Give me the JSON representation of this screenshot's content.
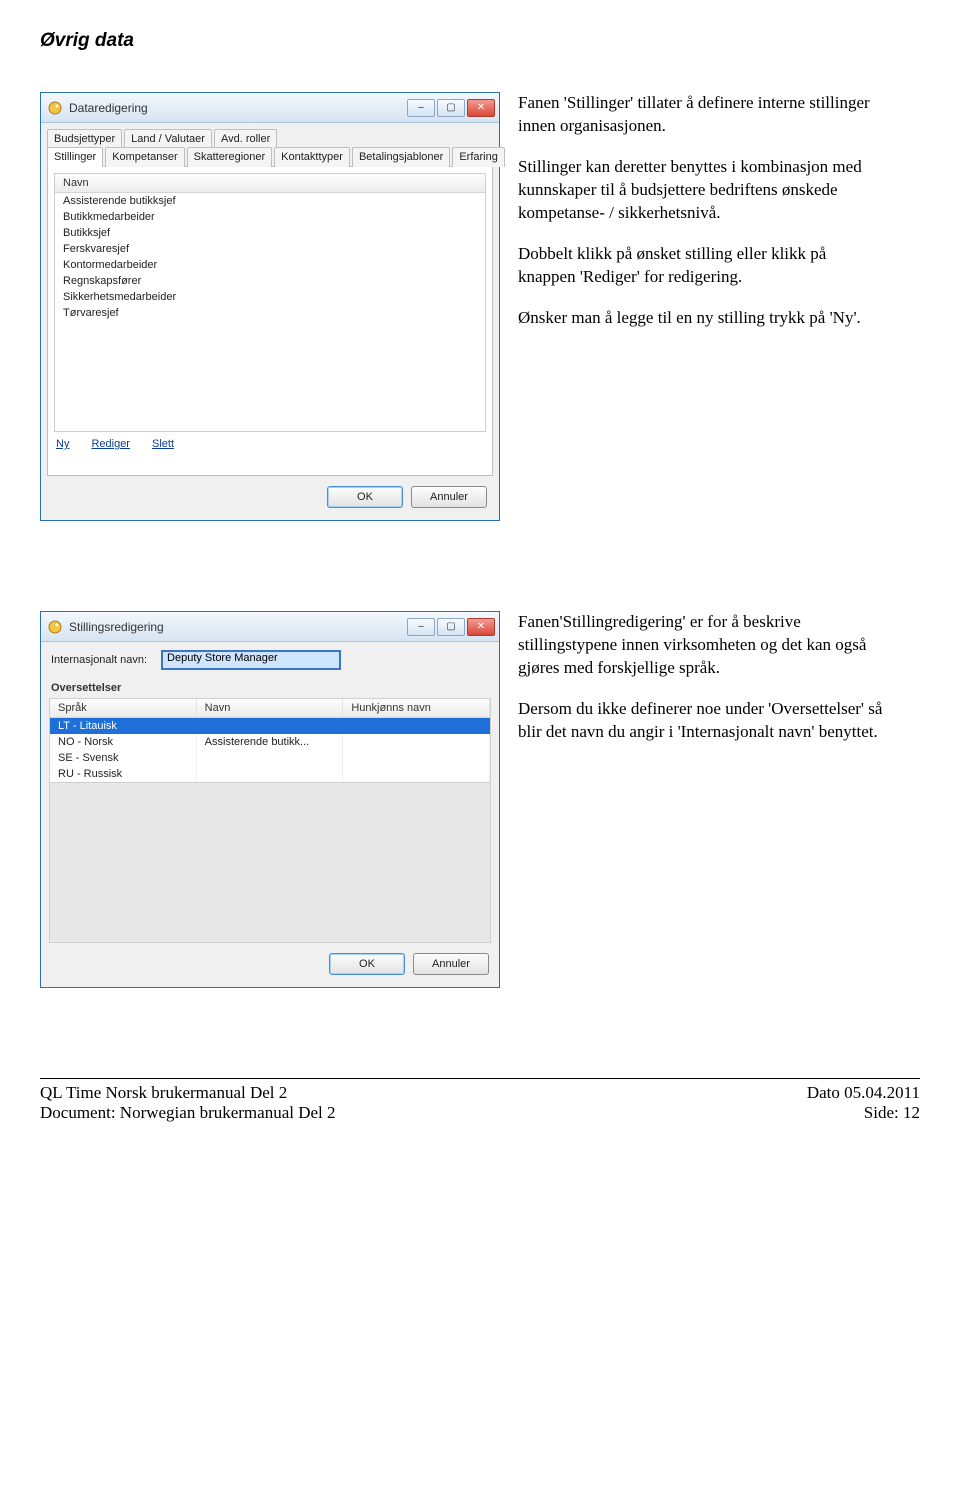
{
  "page": {
    "heading": "Øvrig data"
  },
  "win1": {
    "title": "Dataredigering",
    "tabs_row1": [
      "Budsjettyper",
      "Land / Valutaer",
      "Avd. roller"
    ],
    "tabs_row2": [
      "Stillinger",
      "Kompetanser",
      "Skatteregioner",
      "Kontakttyper",
      "Betalingsjabloner",
      "Erfaring"
    ],
    "active_tab": "Stillinger",
    "col_header": "Navn",
    "rows": [
      "Assisterende butikksjef",
      "Butikkmedarbeider",
      "Butikksjef",
      "Ferskvaresjef",
      "Kontormedarbeider",
      "Regnskapsfører",
      "Sikkerhetsmedarbeider",
      "Tørvaresjef"
    ],
    "links": {
      "ny": "Ny",
      "rediger": "Rediger",
      "slett": "Slett"
    },
    "btn_ok": "OK",
    "btn_cancel": "Annuler"
  },
  "desc1": {
    "p1": "Fanen 'Stillinger' tillater å definere interne stillinger innen organisasjonen.",
    "p2": "Stillinger kan deretter benyttes i kombinasjon med kunnskaper til å budsjettere bedriftens ønskede kompetanse- / sikkerhetsnivå.",
    "p3": "Dobbelt klikk på ønsket stilling eller klikk på knappen 'Rediger' for redigering.",
    "p4": "Ønsker man å legge til en ny stilling trykk på 'Ny'."
  },
  "win2": {
    "title": "Stillingsredigering",
    "field_label": "Internasjonalt navn:",
    "field_value": "Deputy Store Manager",
    "group": "Oversettelser",
    "cols": [
      "Språk",
      "Navn",
      "Hunkjønns navn"
    ],
    "rows": [
      {
        "c1": "LT - Litauisk",
        "c2": "",
        "c3": "",
        "sel": true
      },
      {
        "c1": "NO - Norsk",
        "c2": "Assisterende butikk...",
        "c3": "",
        "sel": false
      },
      {
        "c1": "SE - Svensk",
        "c2": "",
        "c3": "",
        "sel": false
      },
      {
        "c1": "RU - Russisk",
        "c2": "",
        "c3": "",
        "sel": false
      }
    ],
    "btn_ok": "OK",
    "btn_cancel": "Annuler"
  },
  "desc2": {
    "p1": "Fanen'Stillingredigering' er for å beskrive stillingstypene innen virksomheten og det kan også gjøres med forskjellige språk.",
    "p2": "Dersom du ikke definerer noe under 'Oversettelser' så blir det navn du angir i 'Internasjonalt navn' benyttet."
  },
  "footer": {
    "left1": "QL Time Norsk brukermanual Del 2",
    "right1": "Dato 05.04.2011",
    "left2": "Document: Norwegian brukermanual Del 2",
    "right2": "Side: 12"
  }
}
